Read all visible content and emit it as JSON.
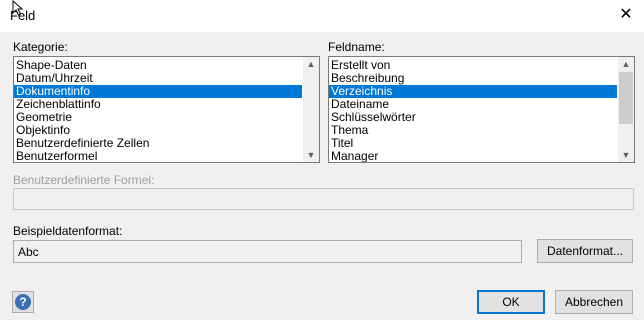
{
  "window": {
    "title": "Feld",
    "close_glyph": "✕"
  },
  "kategorie": {
    "label": "Kategorie:",
    "items": [
      "Shape-Daten",
      "Datum/Uhrzeit",
      "Dokumentinfo",
      "Zeichenblattinfo",
      "Geometrie",
      "Objektinfo",
      "Benutzerdefinierte Zellen",
      "Benutzerformel"
    ],
    "selected_index": 2
  },
  "feldname": {
    "label": "Feldname:",
    "items": [
      "Erstellt von",
      "Beschreibung",
      "Verzeichnis",
      "Dateiname",
      "Schlüsselwörter",
      "Thema",
      "Titel",
      "Manager"
    ],
    "selected_index": 2
  },
  "formel": {
    "label": "Benutzerdefinierte Formel:",
    "value": ""
  },
  "beispiel": {
    "label": "Beispieldatenformat:",
    "value": "Abc",
    "format_button": "Datenformat..."
  },
  "footer": {
    "help_icon": "?",
    "ok": "OK",
    "cancel": "Abbrechen"
  },
  "colors": {
    "selection": "#0078d7",
    "default_button_border": "#0078d7"
  }
}
